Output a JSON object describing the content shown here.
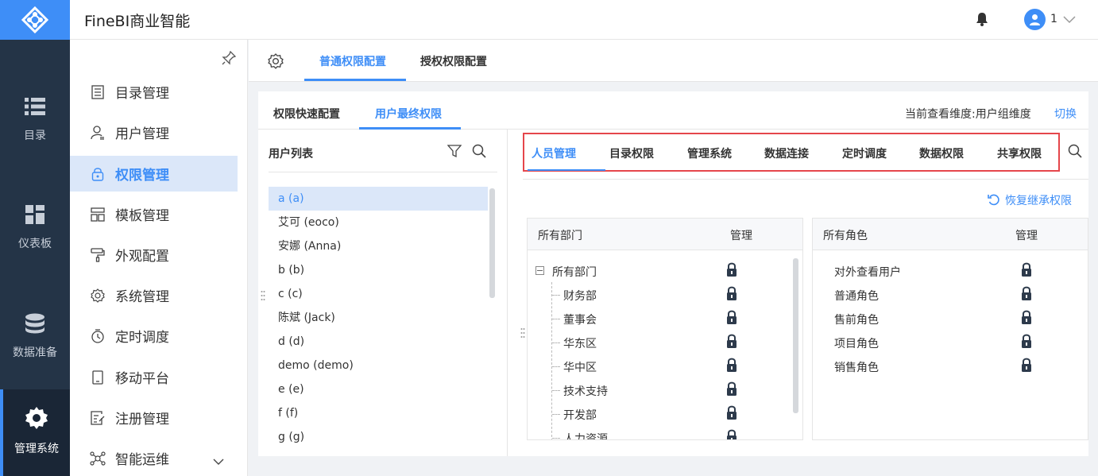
{
  "app": {
    "title": "FineBI商业智能",
    "user_count": "1"
  },
  "rail": [
    {
      "label": "目录",
      "icon": "list-icon"
    },
    {
      "label": "仪表板",
      "icon": "dashboard-icon"
    },
    {
      "label": "数据准备",
      "icon": "database-icon"
    },
    {
      "label": "管理系统",
      "icon": "gear-icon"
    }
  ],
  "subnav": [
    {
      "label": "目录管理",
      "icon": "catalog-icon"
    },
    {
      "label": "用户管理",
      "icon": "user-icon"
    },
    {
      "label": "权限管理",
      "icon": "lock-icon"
    },
    {
      "label": "模板管理",
      "icon": "template-icon"
    },
    {
      "label": "外观配置",
      "icon": "paint-roller-icon"
    },
    {
      "label": "系统管理",
      "icon": "system-gear-icon"
    },
    {
      "label": "定时调度",
      "icon": "timer-icon"
    },
    {
      "label": "移动平台",
      "icon": "mobile-icon"
    },
    {
      "label": "注册管理",
      "icon": "register-icon"
    },
    {
      "label": "智能运维",
      "icon": "ops-icon"
    }
  ],
  "tabs1": [
    "普通权限配置",
    "授权权限配置"
  ],
  "tabs2": [
    "权限快速配置",
    "用户最终权限"
  ],
  "dimension": {
    "label": "当前查看维度:用户组维度",
    "switch": "切换"
  },
  "user_list": {
    "title": "用户列表",
    "users": [
      "a (a)",
      "艾可 (eoco)",
      "安娜 (Anna)",
      "b (b)",
      "c (c)",
      "陈斌 (Jack)",
      "d (d)",
      "demo (demo)",
      "e (e)",
      "f (f)",
      "g (g)"
    ]
  },
  "perm_tabs": [
    "人员管理",
    "目录权限",
    "管理系统",
    "数据连接",
    "定时调度",
    "数据权限",
    "共享权限"
  ],
  "restore": "恢复继承权限",
  "dept_table": {
    "col1": "所有部门",
    "col2": "管理",
    "root": "所有部门",
    "children": [
      "财务部",
      "董事会",
      "华东区",
      "华中区",
      "技术支持",
      "开发部",
      "人力资源"
    ]
  },
  "role_table": {
    "col1": "所有角色",
    "col2": "管理",
    "rows": [
      "对外查看用户",
      "普通角色",
      "售前角色",
      "项目角色",
      "销售角色"
    ]
  },
  "colors": {
    "accent": "#3e8ef7",
    "rail_bg": "#243447",
    "highlight_box": "#e5464b"
  }
}
